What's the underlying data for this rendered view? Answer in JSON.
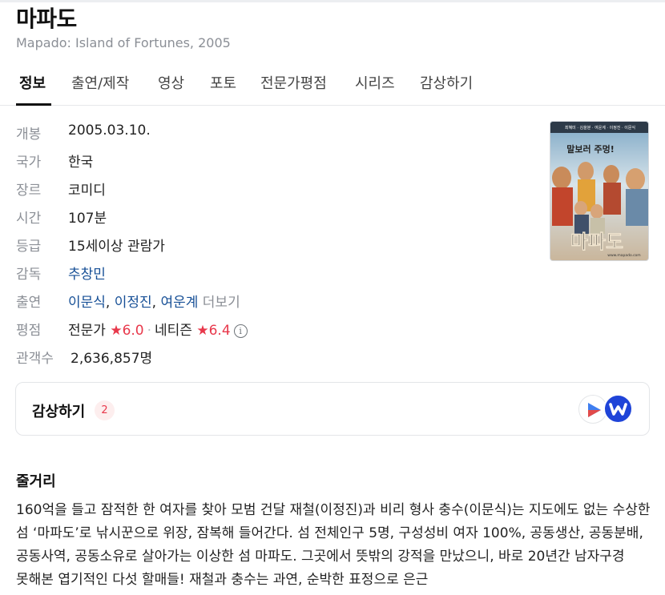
{
  "title": "마파도",
  "subtitle": "Mapado: Island of Fortunes, 2005",
  "tabs": [
    "정보",
    "출연/제작",
    "영상",
    "포토",
    "전문가평점",
    "시리즈",
    "감상하기"
  ],
  "info": {
    "release": {
      "label": "개봉",
      "value": "2005.03.10."
    },
    "country": {
      "label": "국가",
      "value": "한국"
    },
    "genre": {
      "label": "장르",
      "value": "코미디"
    },
    "runtime": {
      "label": "시간",
      "value": "107분"
    },
    "rating": {
      "label": "등급",
      "value": "15세이상 관람가"
    },
    "director": {
      "label": "감독",
      "value": "추창민"
    },
    "cast": {
      "label": "출연",
      "names": [
        "이문식",
        "이정진",
        "여운계"
      ],
      "separator": ",",
      "more": "더보기"
    },
    "score": {
      "label": "평점",
      "critic_label": "전문가",
      "critic_score": "6.0",
      "netizen_label": "네티즌",
      "netizen_score": "6.4",
      "star": "★",
      "dot": "·",
      "info_glyph": "i"
    },
    "audience": {
      "label": "관객수",
      "value": "2,636,857명"
    }
  },
  "poster": {
    "top_text": "최혜미 · 김을분 · 여운계 · 이정진 · 이문식",
    "tagline": "말보러 주멍!",
    "logo": "마파도",
    "url": "www.mapado.com"
  },
  "watch": {
    "title": "감상하기",
    "count": "2",
    "services": [
      "play-service-icon",
      "watcha-icon"
    ]
  },
  "synopsis": {
    "title": "줄거리",
    "text": "160억을 들고 잠적한 한 여자를 찾아 모범 건달 재철(이정진)과 비리 형사 충수(이문식)는 지도에도 없는 수상한 섬 ‘마파도’로 낚시꾼으로 위장, 잠복해 들어간다. 섬 전체인구 5명, 구성성비 여자 100%, 공동생산, 공동분배, 공동사역, 공동소유로 살아가는 이상한 섬 마파도. 그곳에서 뜻밖의 강적을 만났으니, 바로 20년간 남자구경 못해본 엽기적인 다섯 할매들! 재철과 충수는 과연, 순박한 표정으로 은근"
  },
  "colors": {
    "accent_red": "#e8384b",
    "link_blue": "#164f96",
    "label_gray": "#8b8f96",
    "watcha_blue": "#1f44d8"
  }
}
